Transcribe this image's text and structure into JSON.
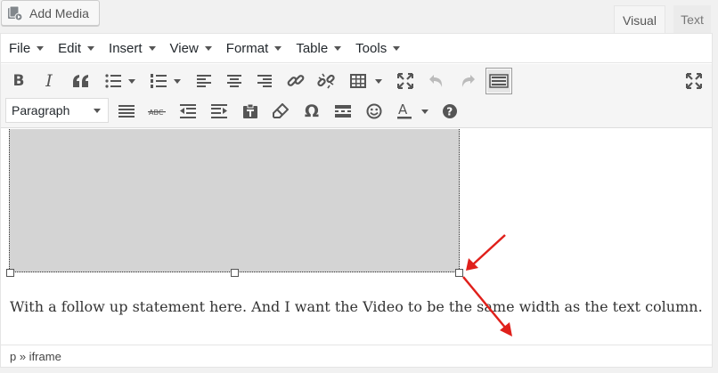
{
  "add_media": {
    "label": "Add Media"
  },
  "tabs": {
    "visual": "Visual",
    "text": "Text"
  },
  "menubar": [
    "File",
    "Edit",
    "Insert",
    "View",
    "Format",
    "Table",
    "Tools"
  ],
  "format_select": {
    "value": "Paragraph"
  },
  "content": {
    "paragraph": "With a follow up statement here. And I want the Video to be the same width as the text column."
  },
  "statusbar": {
    "path": "p » iframe"
  },
  "colors": {
    "annotation_arrow": "#e0201b",
    "video_placeholder": "#d4d4d4"
  }
}
